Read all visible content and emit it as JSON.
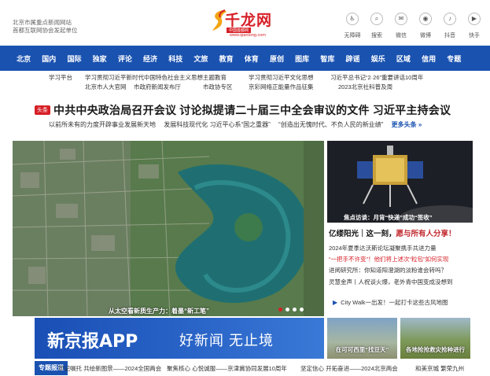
{
  "header": {
    "site_desc_1": "北京市属重点新闻网站",
    "site_desc_2": "首都互联网协会发起单位",
    "logo_text": "千龙网",
    "logo_sub": "中国首都网",
    "logo_domain": "www.qianlong.com",
    "tools": [
      {
        "icon": "accessibility-icon",
        "glyph": "♿",
        "label": "无障碍"
      },
      {
        "icon": "search-icon",
        "glyph": "⌕",
        "label": "搜索"
      },
      {
        "icon": "wechat-icon",
        "glyph": "✉",
        "label": "微信"
      },
      {
        "icon": "weibo-icon",
        "glyph": "◉",
        "label": "微博"
      },
      {
        "icon": "douyin-icon",
        "glyph": "♪",
        "label": "抖音"
      },
      {
        "icon": "kuaishou-icon",
        "glyph": "▶",
        "label": "快手"
      }
    ]
  },
  "nav": [
    "北京",
    "国内",
    "国际",
    "独家",
    "评论",
    "经济",
    "科技",
    "文旅",
    "教育",
    "体育",
    "原创",
    "图库",
    "智库",
    "辟谣",
    "娱乐",
    "区域",
    "信用",
    "专题"
  ],
  "sublinks": {
    "row1": [
      "学习平台",
      "学习贯彻习近平新时代中国特色社会主义思想主题教育",
      "学习贯彻习近平文化思想",
      "习近平总书记“2·26”重要讲话10周年"
    ],
    "row2": [
      "北京市人大官网",
      "市政府新闻发布厅",
      "市政协专区",
      "京彩网络正能量作品征集",
      "2023北京社科普及周"
    ]
  },
  "headline": {
    "badge": "头条",
    "text": "中共中央政治局召开会议 讨论拟提请二十届三中全会审议的文件 习近平主持会议",
    "subs": [
      "以前所未有的力度开辟事业发展新天地",
      "发展科技现代化 习近平心系“国之重器”",
      "“创造出无愧时代、不负人民的新业绩”"
    ],
    "more": "更多头条 »"
  },
  "main": {
    "caption": "从太空看新质生产力：着墨“新工笔”"
  },
  "side": {
    "caption": "焦点访谈：月背“快递”成功“签收”",
    "title_part1": "亿缕阳光｜这一刻，",
    "title_part2": "愿与所有人分享！",
    "news": [
      "2024年夏季达沃斯论坛凝聚携手共进力量",
      "“一把手不许变”！他们将上述次“粒包”如何实现",
      "进阅研究所：你知道阳澄湖的淡粉谁会转吗？",
      "灵慧金声丨人祝谈火爆，老外青中国变成没想到"
    ],
    "walk": "City Walk一出发！一起打卡这些古风地图"
  },
  "banner": {
    "main": "新京报APP",
    "sub": "好新闻 无止境"
  },
  "thumbs": [
    {
      "caption": "在可可西里“找豆天”"
    },
    {
      "caption": "各地抢抢救灾抢种进行"
    }
  ],
  "ticker": {
    "badge": "专题报道",
    "items": [
      "牢记嘱托 共绘新图景——2024全国两会",
      "聚焦核心 心悦诚服——京津冀协同发展10周年",
      "坚定信心 开拓奋进——2024北京两会",
      "和美京城 繁荣九州"
    ]
  }
}
